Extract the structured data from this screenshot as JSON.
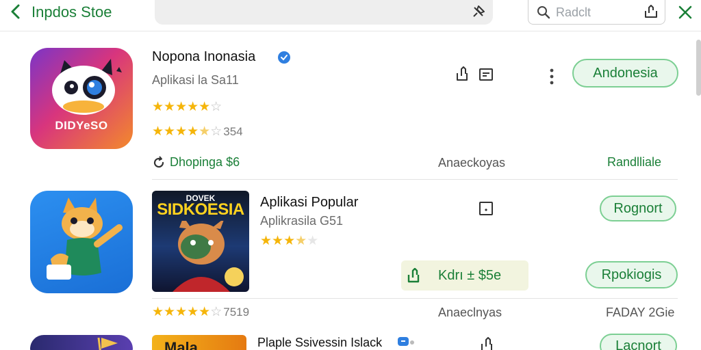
{
  "header": {
    "store_title": "Inpdos Stoe",
    "search_text": "Radclt"
  },
  "apps": [
    {
      "name": "Nopona Inonasia",
      "subtitle": "Aplikasi la Sa11",
      "icon_label": "DIDYeSO",
      "stars_primary": "★★★★★",
      "stars_secondary": "★★★★",
      "rating_count": "354",
      "developer": "Dhopinga $6",
      "category": "Anaeckoyas",
      "status": "Randlliale",
      "button_label": "Andonesia"
    },
    {
      "name": "Aplikasi Popular",
      "subtitle": "Aplikrasila G51",
      "thumb_top": "DOVEK",
      "thumb_title": "SIDKOESIA",
      "stars_primary": "★★★",
      "stars_secondary": "★★★★",
      "rating_count": "7519",
      "price_label": "Kdrı ± $5e",
      "category": "Anaeclnyas",
      "status": "FADAY 2Gie",
      "button_label_top": "Rognort",
      "button_label_bottom": "Rpokiogis"
    },
    {
      "name": "Plaple Ssivessin Islack",
      "thumb_text": "Mala",
      "button_label": "Lacnort"
    }
  ],
  "colors": {
    "accent_green": "#1a7f37",
    "button_fill": "#e9f7ec",
    "button_border": "#7ccf93",
    "star_gold": "#f5b50a"
  }
}
